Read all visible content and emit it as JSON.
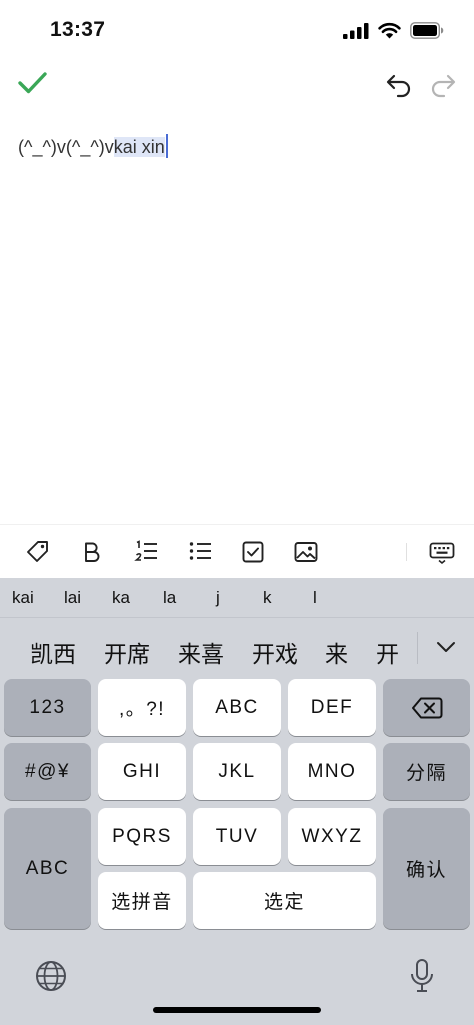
{
  "status": {
    "time": "13:37"
  },
  "editor": {
    "text_plain": "(^_^)v(^_^)vkai xin",
    "text_before": "(^_^)v(^_^)v",
    "text_marked": "kai xin",
    "accent_color": "#4a6cd4"
  },
  "toolbar": {
    "confirm_color": "#3aa757"
  },
  "keyboard": {
    "pinyin_options": [
      "kai",
      "lai",
      "ka",
      "la",
      "j",
      "k",
      "l"
    ],
    "candidates": [
      "凯西",
      "开席",
      "来喜",
      "开戏",
      "来",
      "开"
    ],
    "keys": {
      "numbers": "123",
      "punct": ",。?!",
      "abc": "ABC",
      "def": "DEF",
      "symbols": "#@¥",
      "ghi": "GHI",
      "jkl": "JKL",
      "mno": "MNO",
      "split": "分隔",
      "abc_switch": "ABC",
      "pqrs": "PQRS",
      "tuv": "TUV",
      "wxyz": "WXYZ",
      "confirm": "确认",
      "select_pinyin": "选拼音",
      "select": "选定"
    }
  }
}
